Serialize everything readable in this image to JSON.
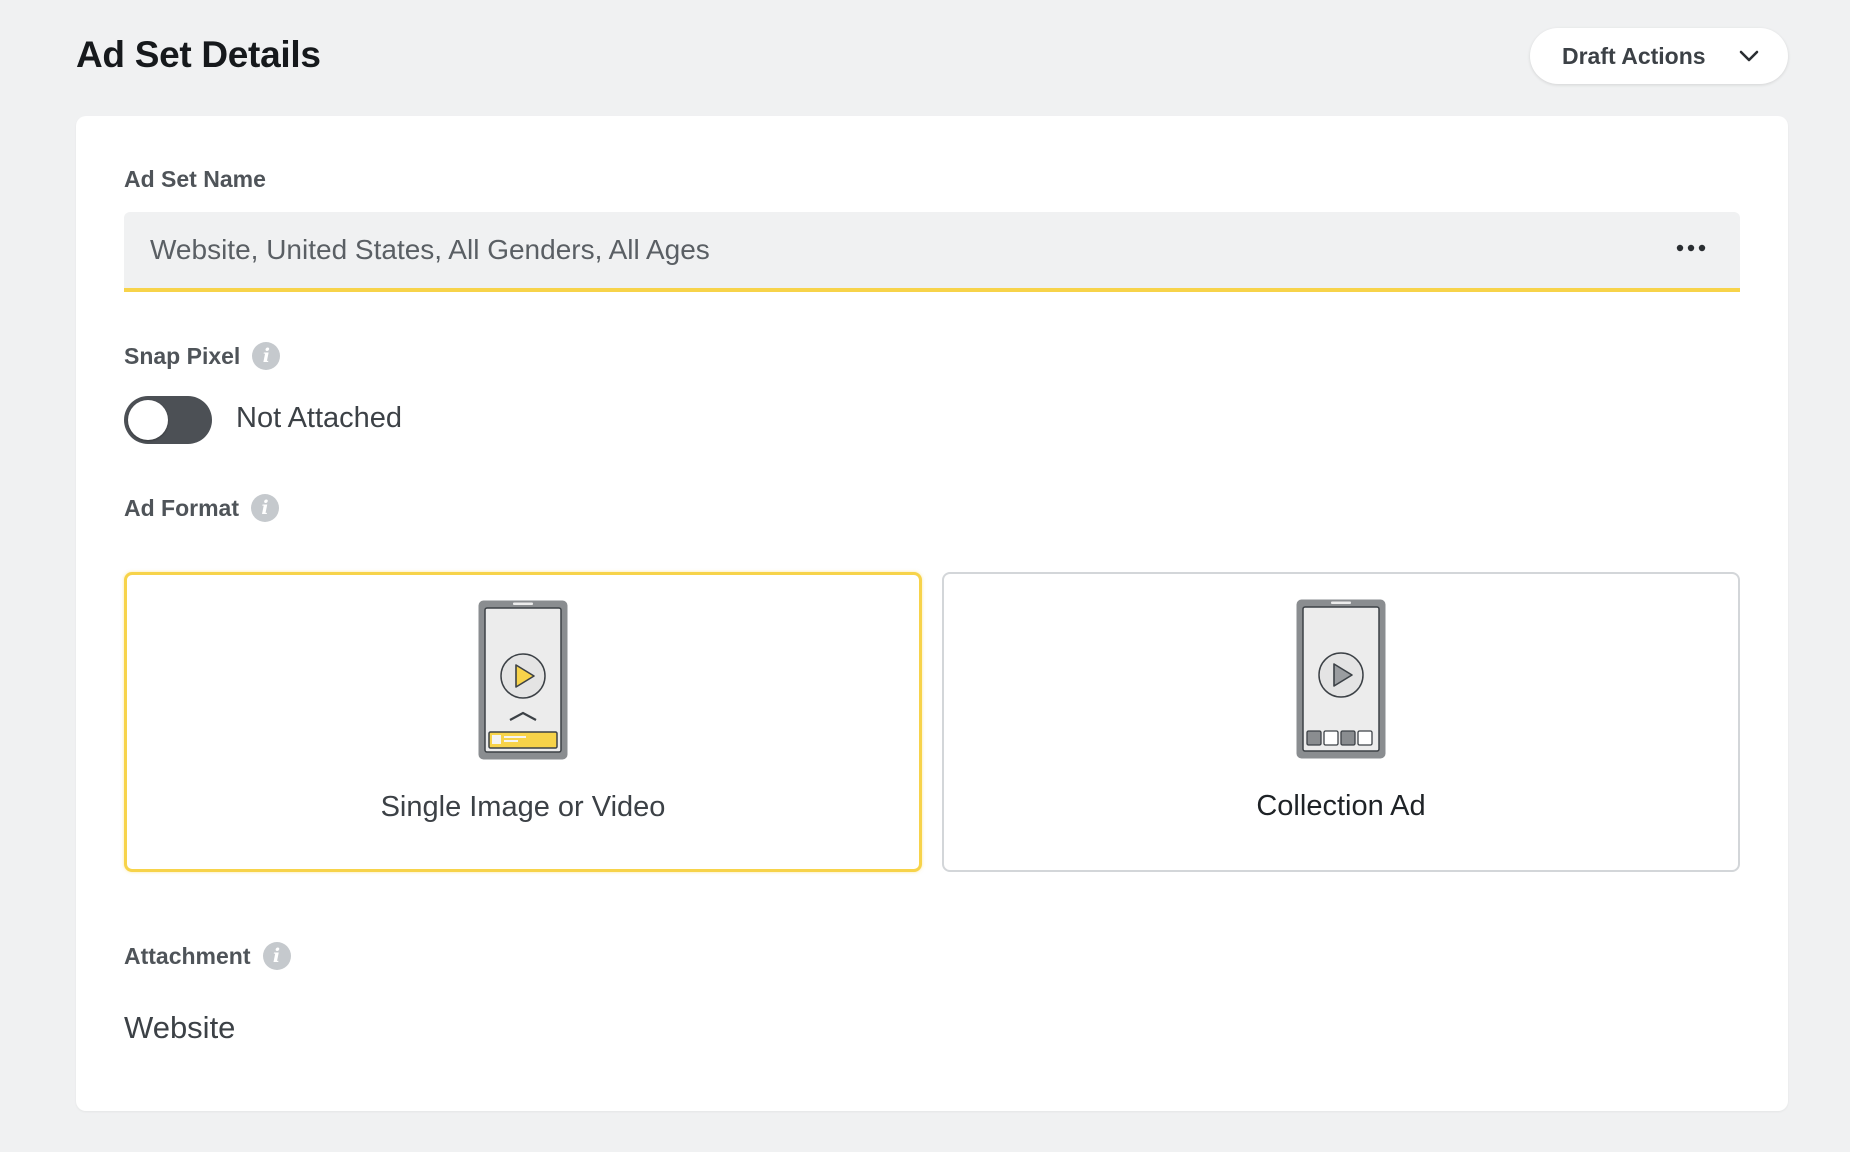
{
  "header": {
    "title": "Ad Set Details",
    "draft_actions_label": "Draft Actions"
  },
  "ad_set_name": {
    "label": "Ad Set Name",
    "value": "Website, United States, All Genders, All Ages"
  },
  "snap_pixel": {
    "label": "Snap Pixel",
    "toggle_on": false,
    "status": "Not Attached"
  },
  "ad_format": {
    "label": "Ad Format",
    "options": [
      {
        "label": "Single Image or Video",
        "selected": true,
        "icon": "phone-single-video-icon"
      },
      {
        "label": "Collection Ad",
        "selected": false,
        "icon": "phone-collection-icon"
      }
    ]
  },
  "attachment": {
    "label": "Attachment",
    "value": "Website"
  },
  "colors": {
    "accent": "#f7d34a",
    "toggle_off": "#4c5055",
    "background": "#f0f1f2"
  }
}
